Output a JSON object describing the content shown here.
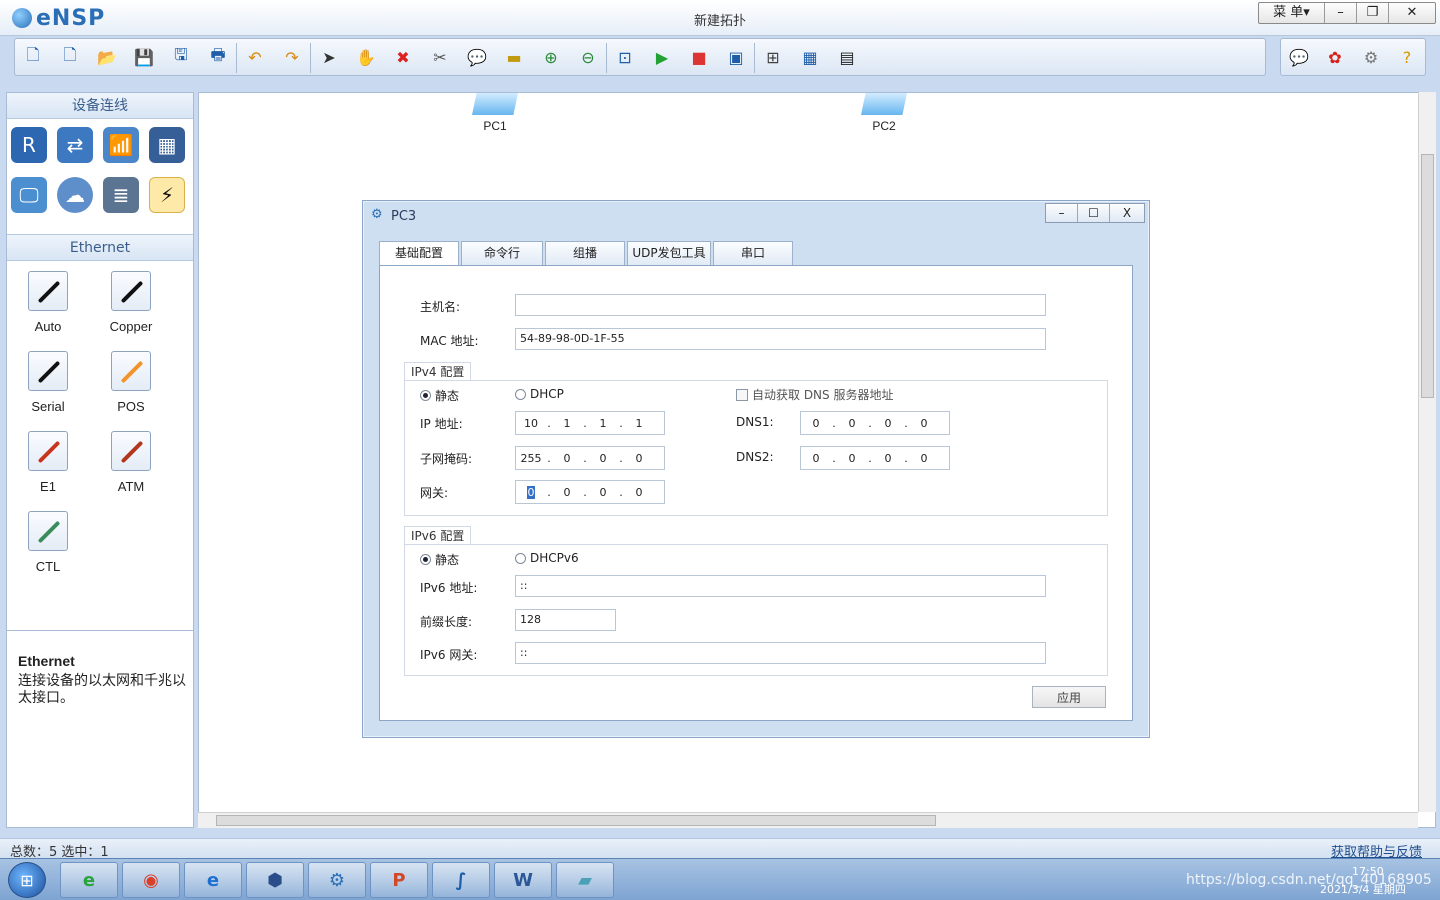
{
  "app": {
    "name": "eNSP",
    "title": "新建拓扑",
    "menu_label": "菜 单▾"
  },
  "toolbar": {
    "left_icons": [
      "new-topology-icon",
      "new-test-icon",
      "open-icon",
      "save-icon",
      "save-as-icon",
      "print-icon",
      "undo-icon",
      "redo-icon",
      "select-icon",
      "pan-hand-icon",
      "delete-icon",
      "delete-link-icon",
      "text-icon",
      "rectangle-icon",
      "zoom-in-icon",
      "zoom-out-icon",
      "fit-window-icon",
      "start-device-icon",
      "stop-device-icon",
      "capture-icon",
      "topology-icon",
      "grid-icon",
      "screenshot-icon"
    ],
    "right_icons": [
      "chat-icon",
      "huawei-logo-icon",
      "settings-icon",
      "help-icon"
    ]
  },
  "left_panel": {
    "device_section_title": "设备连线",
    "devices": [
      "router-icon",
      "switch-icon",
      "wlan-icon",
      "firewall-icon",
      "pc-icon",
      "cloud-icon",
      "other-device-icon",
      "cable-icon"
    ],
    "cable_section_title": "Ethernet",
    "cables": [
      {
        "label": "Auto",
        "color": "#111111"
      },
      {
        "label": "Copper",
        "color": "#111111"
      },
      {
        "label": "Serial",
        "color": "#111111"
      },
      {
        "label": "POS",
        "color": "#f2932d"
      },
      {
        "label": "E1",
        "color": "#c8351e"
      },
      {
        "label": "ATM",
        "color": "#b3361e"
      },
      {
        "label": "CTL",
        "color": "#3a8c5a"
      }
    ],
    "desc_title": "Ethernet",
    "desc_text": "连接设备的以太网和千兆以太接口。"
  },
  "canvas": {
    "nodes": [
      {
        "label": "PC1"
      },
      {
        "label": "PC2"
      }
    ]
  },
  "dialog": {
    "title": "PC3",
    "tabs": [
      "基础配置",
      "命令行",
      "组播",
      "UDP发包工具",
      "串口"
    ],
    "active_tab": "基础配置",
    "hostname_label": "主机名:",
    "hostname_value": "",
    "mac_label": "MAC 地址:",
    "mac_value": "54-89-98-0D-1F-55",
    "ipv4": {
      "group_title": "IPv4 配置",
      "static_label": "静态",
      "dhcp_label": "DHCP",
      "auto_dns_label": "自动获取 DNS 服务器地址",
      "ip_label": "IP 地址:",
      "ip_value": [
        "10",
        "1",
        "1",
        "1"
      ],
      "mask_label": "子网掩码:",
      "mask_value": [
        "255",
        "0",
        "0",
        "0"
      ],
      "gateway_label": "网关:",
      "gateway_value": [
        "0",
        "0",
        "0",
        "0"
      ],
      "dns1_label": "DNS1:",
      "dns1_value": [
        "0",
        "0",
        "0",
        "0"
      ],
      "dns2_label": "DNS2:",
      "dns2_value": [
        "0",
        "0",
        "0",
        "0"
      ]
    },
    "ipv6": {
      "group_title": "IPv6 配置",
      "static_label": "静态",
      "dhcp_label": "DHCPv6",
      "ip_label": "IPv6 地址:",
      "ip_value": "::",
      "prefix_label": "前缀长度:",
      "prefix_value": "128",
      "gateway_label": "IPv6 网关:",
      "gateway_value": "::"
    },
    "apply_label": "应用"
  },
  "status": {
    "summary": "总数：5  选中：1",
    "help_link": "获取帮助与反馈"
  },
  "taskbar": {
    "apps": [
      "windows-start-icon",
      "360-browser-icon",
      "chrome-icon",
      "ie-icon",
      "virtualbox-icon",
      "ensp-icon",
      "powerpoint-icon",
      "wireshark-icon",
      "word-icon",
      "notebook-icon"
    ],
    "time": "17:50",
    "date": "2021/3/4 星期四",
    "watermark": "https://blog.csdn.net/qq_40168905"
  }
}
